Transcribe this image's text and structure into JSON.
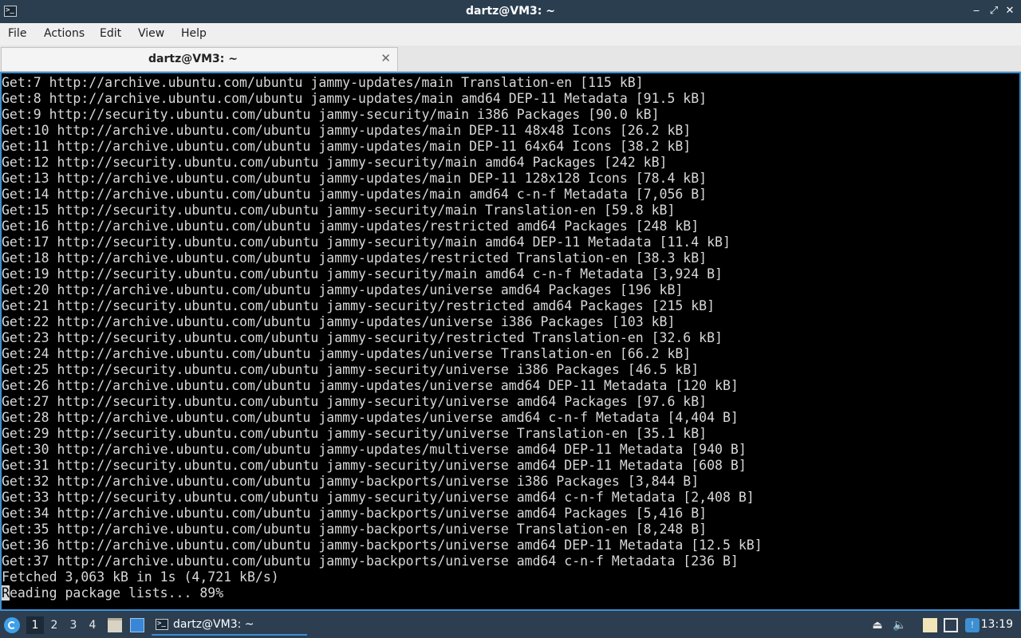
{
  "window": {
    "title": "dartz@VM3: ~",
    "controls": {
      "minimize": "‒",
      "maximize": "⤢",
      "close": "✕"
    }
  },
  "menubar": [
    "File",
    "Actions",
    "Edit",
    "View",
    "Help"
  ],
  "tab": {
    "label": "dartz@VM3: ~",
    "close": "✕"
  },
  "terminal": {
    "lines": [
      "Get:7 http://archive.ubuntu.com/ubuntu jammy-updates/main Translation-en [115 kB]",
      "Get:8 http://archive.ubuntu.com/ubuntu jammy-updates/main amd64 DEP-11 Metadata [91.5 kB]",
      "Get:9 http://security.ubuntu.com/ubuntu jammy-security/main i386 Packages [90.0 kB]",
      "Get:10 http://archive.ubuntu.com/ubuntu jammy-updates/main DEP-11 48x48 Icons [26.2 kB]",
      "Get:11 http://archive.ubuntu.com/ubuntu jammy-updates/main DEP-11 64x64 Icons [38.2 kB]",
      "Get:12 http://security.ubuntu.com/ubuntu jammy-security/main amd64 Packages [242 kB]",
      "Get:13 http://archive.ubuntu.com/ubuntu jammy-updates/main DEP-11 128x128 Icons [78.4 kB]",
      "Get:14 http://archive.ubuntu.com/ubuntu jammy-updates/main amd64 c-n-f Metadata [7,056 B]",
      "Get:15 http://security.ubuntu.com/ubuntu jammy-security/main Translation-en [59.8 kB]",
      "Get:16 http://archive.ubuntu.com/ubuntu jammy-updates/restricted amd64 Packages [248 kB]",
      "Get:17 http://security.ubuntu.com/ubuntu jammy-security/main amd64 DEP-11 Metadata [11.4 kB]",
      "Get:18 http://archive.ubuntu.com/ubuntu jammy-updates/restricted Translation-en [38.3 kB]",
      "Get:19 http://security.ubuntu.com/ubuntu jammy-security/main amd64 c-n-f Metadata [3,924 B]",
      "Get:20 http://archive.ubuntu.com/ubuntu jammy-updates/universe amd64 Packages [196 kB]",
      "Get:21 http://security.ubuntu.com/ubuntu jammy-security/restricted amd64 Packages [215 kB]",
      "Get:22 http://archive.ubuntu.com/ubuntu jammy-updates/universe i386 Packages [103 kB]",
      "Get:23 http://security.ubuntu.com/ubuntu jammy-security/restricted Translation-en [32.6 kB]",
      "Get:24 http://archive.ubuntu.com/ubuntu jammy-updates/universe Translation-en [66.2 kB]",
      "Get:25 http://security.ubuntu.com/ubuntu jammy-security/universe i386 Packages [46.5 kB]",
      "Get:26 http://archive.ubuntu.com/ubuntu jammy-updates/universe amd64 DEP-11 Metadata [120 kB]",
      "Get:27 http://security.ubuntu.com/ubuntu jammy-security/universe amd64 Packages [97.6 kB]",
      "Get:28 http://archive.ubuntu.com/ubuntu jammy-updates/universe amd64 c-n-f Metadata [4,404 B]",
      "Get:29 http://security.ubuntu.com/ubuntu jammy-security/universe Translation-en [35.1 kB]",
      "Get:30 http://archive.ubuntu.com/ubuntu jammy-updates/multiverse amd64 DEP-11 Metadata [940 B]",
      "Get:31 http://security.ubuntu.com/ubuntu jammy-security/universe amd64 DEP-11 Metadata [608 B]",
      "Get:32 http://archive.ubuntu.com/ubuntu jammy-backports/universe i386 Packages [3,844 B]",
      "Get:33 http://security.ubuntu.com/ubuntu jammy-security/universe amd64 c-n-f Metadata [2,408 B]",
      "Get:34 http://archive.ubuntu.com/ubuntu jammy-backports/universe amd64 Packages [5,416 B]",
      "Get:35 http://archive.ubuntu.com/ubuntu jammy-backports/universe Translation-en [8,248 B]",
      "Get:36 http://archive.ubuntu.com/ubuntu jammy-backports/universe amd64 DEP-11 Metadata [12.5 kB]",
      "Get:37 http://archive.ubuntu.com/ubuntu jammy-backports/universe amd64 c-n-f Metadata [236 B]",
      "Fetched 3,063 kB in 1s (4,721 kB/s)"
    ],
    "last_line_cursor_char": "R",
    "last_line_rest": "eading package lists... 89%"
  },
  "taskbar": {
    "workspaces": [
      "1",
      "2",
      "3",
      "4"
    ],
    "active_workspace": "1",
    "task_label": "dartz@VM3: ~",
    "clock": "13:19",
    "tray_icons": [
      "drive-icon",
      "volume-icon",
      "clipboard-icon",
      "network-icon",
      "update-icon"
    ]
  },
  "colors": {
    "titlebar_bg": "#2b3e50",
    "terminal_bg": "#000000",
    "terminal_fg": "#d8d8d8",
    "accent": "#3d8fd1"
  }
}
